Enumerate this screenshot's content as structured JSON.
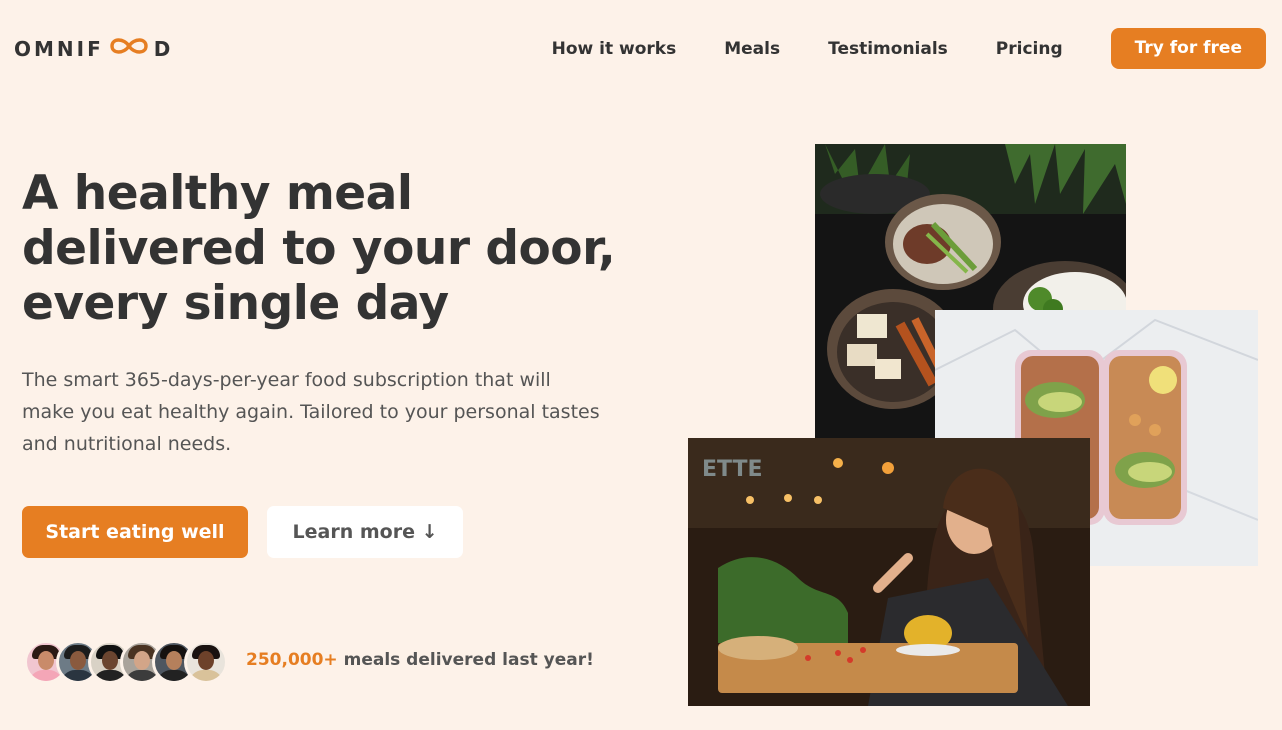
{
  "header": {
    "logo_text_left": "OMNIF",
    "logo_text_right": "D",
    "nav": [
      {
        "label": "How it works"
      },
      {
        "label": "Meals"
      },
      {
        "label": "Testimonials"
      },
      {
        "label": "Pricing"
      }
    ],
    "cta_label": "Try for free"
  },
  "hero": {
    "title": "A healthy meal delivered to your door, every single day",
    "description": "The smart 365-days-per-year food subscription that will make you eat healthy again. Tailored to your personal tastes and nutritional needs.",
    "primary_button": "Start eating well",
    "secondary_button": "Learn more ↓",
    "delivered_count": "250,000+",
    "delivered_text": " meals delivered last year!",
    "shop_sign": "ETTE"
  },
  "colors": {
    "background": "#fdf2e9",
    "accent": "#e67e22",
    "text": "#333333"
  },
  "icons": [
    "infinity-logo-icon",
    "arrow-down-glyph"
  ]
}
